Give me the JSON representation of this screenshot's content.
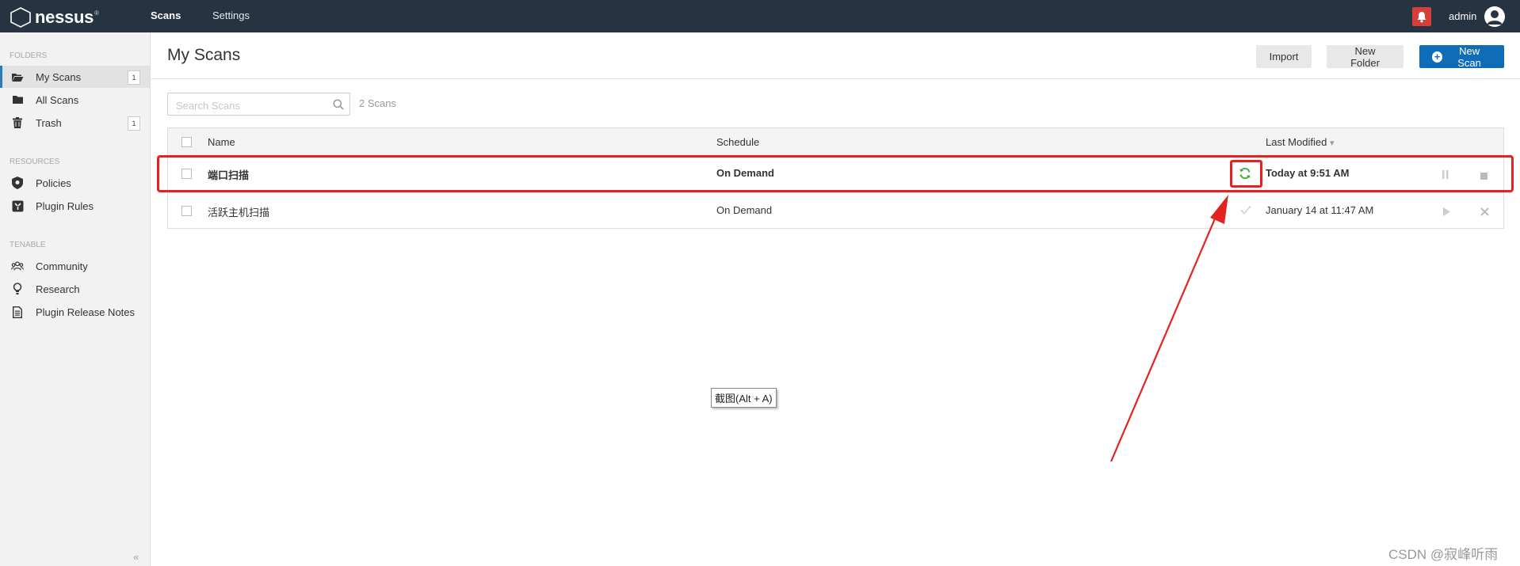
{
  "app": {
    "logo_text": "nessus",
    "logo_tm": "®",
    "nav": [
      {
        "label": "Scans",
        "active": true
      },
      {
        "label": "Settings",
        "active": false
      }
    ],
    "user": "admin",
    "colors": {
      "topbar": "#263340",
      "accent": "#0f6cb6",
      "alert": "#d43f3a",
      "running": "#3aaa35",
      "annotation": "#e32322"
    }
  },
  "sidebar": {
    "folders_heading": "FOLDERS",
    "folders": [
      {
        "label": "My Scans",
        "icon": "folder-open-icon",
        "count": "1",
        "active": true
      },
      {
        "label": "All Scans",
        "icon": "folder-icon",
        "count": "",
        "active": false
      },
      {
        "label": "Trash",
        "icon": "trash-icon",
        "count": "1",
        "active": false
      }
    ],
    "resources_heading": "RESOURCES",
    "resources": [
      {
        "label": "Policies",
        "icon": "shield-icon"
      },
      {
        "label": "Plugin Rules",
        "icon": "plugin-rules-icon"
      }
    ],
    "tenable_heading": "TENABLE",
    "tenable": [
      {
        "label": "Community",
        "icon": "community-icon"
      },
      {
        "label": "Research",
        "icon": "lightbulb-icon"
      },
      {
        "label": "Plugin Release Notes",
        "icon": "document-icon"
      }
    ],
    "collapse": "«"
  },
  "main": {
    "title": "My Scans",
    "buttons": {
      "import": "Import",
      "new_folder": "New Folder",
      "new_scan": "New Scan"
    },
    "search_placeholder": "Search Scans",
    "scan_count": "2 Scans",
    "table": {
      "headers": {
        "name": "Name",
        "schedule": "Schedule",
        "last_modified": "Last Modified",
        "sort": "▾"
      },
      "rows": [
        {
          "name": "端口扫描",
          "schedule": "On Demand",
          "status": "running",
          "last_modified": "Today at 9:51 AM",
          "actions": [
            "pause-icon",
            "stop-icon"
          ]
        },
        {
          "name": "活跃主机扫描",
          "schedule": "On Demand",
          "status": "completed",
          "last_modified": "January 14 at 11:47 AM",
          "actions": [
            "play-icon",
            "delete-icon"
          ]
        }
      ]
    }
  },
  "overlay": {
    "tooltip": "截图(Alt + A)",
    "watermark": "CSDN @寂峰听雨"
  }
}
